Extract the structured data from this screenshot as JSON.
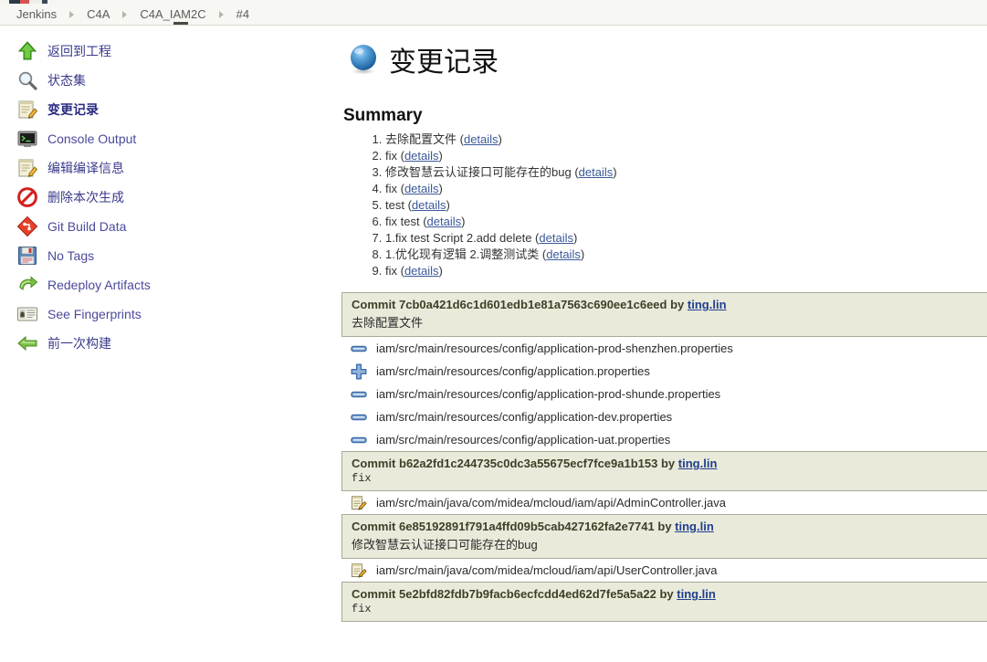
{
  "breadcrumb": {
    "items": [
      {
        "label": "Jenkins"
      },
      {
        "label": "C4A"
      },
      {
        "label": "C4A_IAM2C"
      },
      {
        "label": "#4"
      }
    ]
  },
  "sidebar": {
    "items": [
      {
        "label": "返回到工程",
        "icon": "up-arrow-icon",
        "lang": "cn",
        "active": false
      },
      {
        "label": "状态集",
        "icon": "magnifier-icon",
        "lang": "cn",
        "active": false
      },
      {
        "label": "变更记录",
        "icon": "notepad-edit-icon",
        "lang": "cn",
        "active": true
      },
      {
        "label": "Console Output",
        "icon": "terminal-icon",
        "lang": "en",
        "active": false
      },
      {
        "label": "编辑编译信息",
        "icon": "notepad-edit-icon",
        "lang": "cn",
        "active": false
      },
      {
        "label": "删除本次生成",
        "icon": "delete-forbidden-icon",
        "lang": "cn",
        "active": false
      },
      {
        "label": "Git Build Data",
        "icon": "git-diamond-icon",
        "lang": "en",
        "active": false
      },
      {
        "label": "No Tags",
        "icon": "floppy-disk-icon",
        "lang": "en",
        "active": false
      },
      {
        "label": "Redeploy Artifacts",
        "icon": "green-redeploy-arrow-icon",
        "lang": "en",
        "active": false
      },
      {
        "label": "See Fingerprints",
        "icon": "fingerprint-card-icon",
        "lang": "en",
        "active": false
      },
      {
        "label": "前一次构建",
        "icon": "left-arrow-icon",
        "lang": "cn",
        "active": false
      }
    ]
  },
  "main": {
    "title": "变更记录",
    "title_icon": "blue-orb-icon",
    "summary_heading": "Summary",
    "summary": [
      {
        "text": "去除配置文件",
        "link": "details"
      },
      {
        "text": "fix",
        "link": "details"
      },
      {
        "text": "修改智慧云认证接口可能存在的bug",
        "link": "details"
      },
      {
        "text": "fix",
        "link": "details"
      },
      {
        "text": "test",
        "link": "details"
      },
      {
        "text": "fix test",
        "link": "details"
      },
      {
        "text": "1.fix test Script 2.add delete",
        "link": "details"
      },
      {
        "text": "1.优化现有逻辑 2.调整测试类",
        "link": "details"
      },
      {
        "text": "fix",
        "link": "details"
      }
    ],
    "commit_prefix": "Commit",
    "by_word": "by",
    "commits": [
      {
        "hash": "7cb0a421d6c1d601edb1e81a7563c690ee1c6eed",
        "author": "ting.lin",
        "message": "去除配置文件",
        "message_mono": false,
        "files": [
          {
            "icon": "file-modified-icon",
            "path": "iam/src/main/resources/config/application-prod-shenzhen.properties"
          },
          {
            "icon": "file-added-icon",
            "path": "iam/src/main/resources/config/application.properties"
          },
          {
            "icon": "file-modified-icon",
            "path": "iam/src/main/resources/config/application-prod-shunde.properties"
          },
          {
            "icon": "file-modified-icon",
            "path": "iam/src/main/resources/config/application-dev.properties"
          },
          {
            "icon": "file-modified-icon",
            "path": "iam/src/main/resources/config/application-uat.properties"
          }
        ]
      },
      {
        "hash": "b62a2fd1c244735c0dc3a55675ecf7fce9a1b153",
        "author": "ting.lin",
        "message": "fix",
        "message_mono": true,
        "files": [
          {
            "icon": "file-edit-icon",
            "path": "iam/src/main/java/com/midea/mcloud/iam/api/AdminController.java"
          }
        ]
      },
      {
        "hash": "6e85192891f791a4ffd09b5cab427162fa2e7741",
        "author": "ting.lin",
        "message": "修改智慧云认证接口可能存在的bug",
        "message_mono": false,
        "files": [
          {
            "icon": "file-edit-icon",
            "path": "iam/src/main/java/com/midea/mcloud/iam/api/UserController.java"
          }
        ]
      },
      {
        "hash": "5e2bfd82fdb7b9facb6ecfcdd4ed62d7fe5a5a22",
        "author": "ting.lin",
        "message": "fix",
        "message_mono": true,
        "files": []
      }
    ]
  },
  "colors": {
    "breadcrumb_bg": "#f7f8f3",
    "commit_head_bg": "#eaeadb",
    "commit_border": "#a9a999",
    "link_blue": "#4a4a9c",
    "detail_link": "#3b5998"
  }
}
